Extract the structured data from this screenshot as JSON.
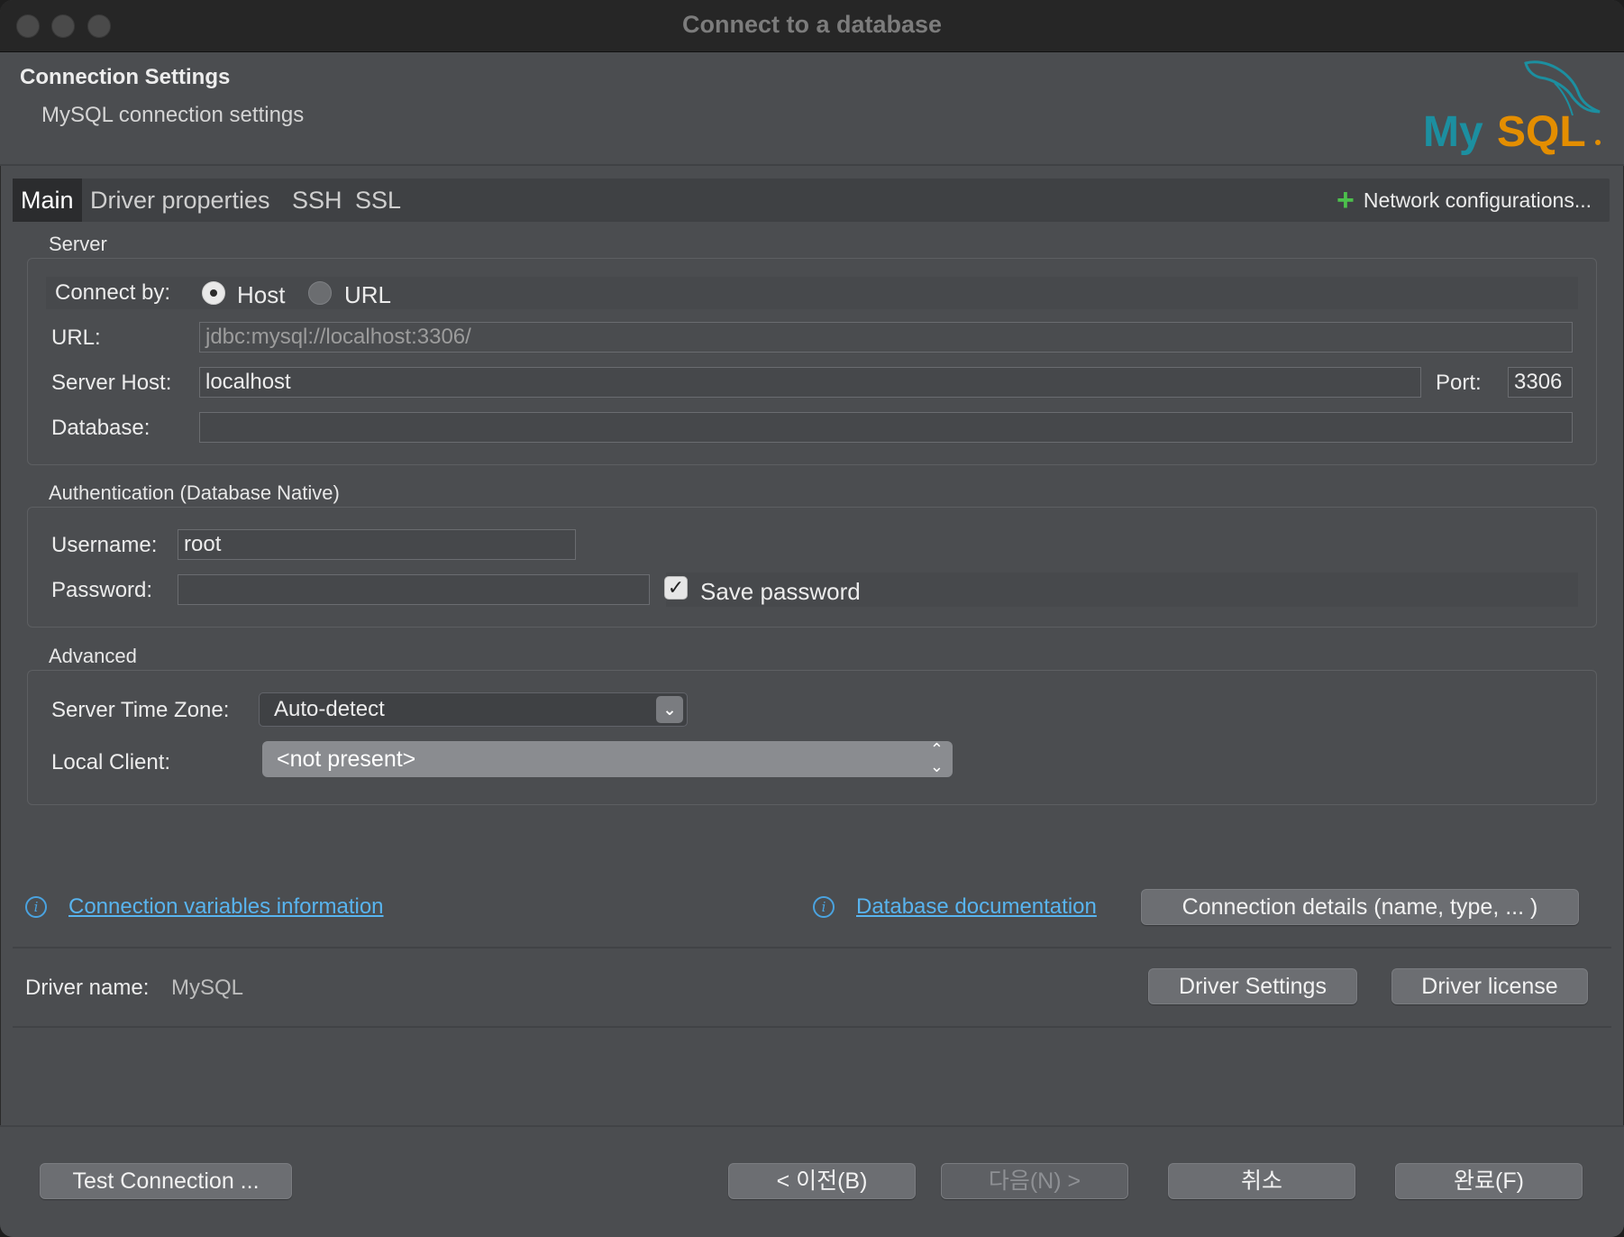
{
  "window": {
    "title": "Connect to a database"
  },
  "header": {
    "title": "Connection Settings",
    "subtitle": "MySQL connection settings",
    "logo_text": "MySQL"
  },
  "tabs": [
    {
      "label": "Main",
      "active": true
    },
    {
      "label": "Driver properties",
      "active": false
    },
    {
      "label": "SSH",
      "active": false
    },
    {
      "label": "SSL",
      "active": false
    }
  ],
  "network_config": {
    "label": "Network configurations..."
  },
  "server": {
    "group_label": "Server",
    "connect_by_label": "Connect by:",
    "host_option": "Host",
    "url_option": "URL",
    "selected": "Host",
    "url_label": "URL:",
    "url_value": "jdbc:mysql://localhost:3306/",
    "host_label": "Server Host:",
    "host_value": "localhost",
    "port_label": "Port:",
    "port_value": "3306",
    "database_label": "Database:",
    "database_value": ""
  },
  "auth": {
    "group_label": "Authentication (Database Native)",
    "username_label": "Username:",
    "username_value": "root",
    "password_label": "Password:",
    "password_value": "",
    "save_password_label": "Save password",
    "save_password_checked": true
  },
  "advanced": {
    "group_label": "Advanced",
    "timezone_label": "Server Time Zone:",
    "timezone_value": "Auto-detect",
    "local_client_label": "Local Client:",
    "local_client_value": "<not present>"
  },
  "links": {
    "conn_vars": "Connection variables information",
    "db_docs": "Database documentation",
    "conn_details_button": "Connection details (name, type, ... )"
  },
  "driver": {
    "name_label": "Driver name:",
    "name_value": "MySQL",
    "settings_button": "Driver Settings",
    "license_button": "Driver license"
  },
  "footer": {
    "test_button": "Test Connection ...",
    "back_button": "< 이전(B)",
    "next_button": "다음(N) >",
    "cancel_button": "취소",
    "finish_button": "완료(F)"
  },
  "colors": {
    "accent_link": "#58b4ef",
    "plus_green": "#4cc04c",
    "logo_teal": "#1c8fa0",
    "logo_orange": "#e48e00"
  }
}
